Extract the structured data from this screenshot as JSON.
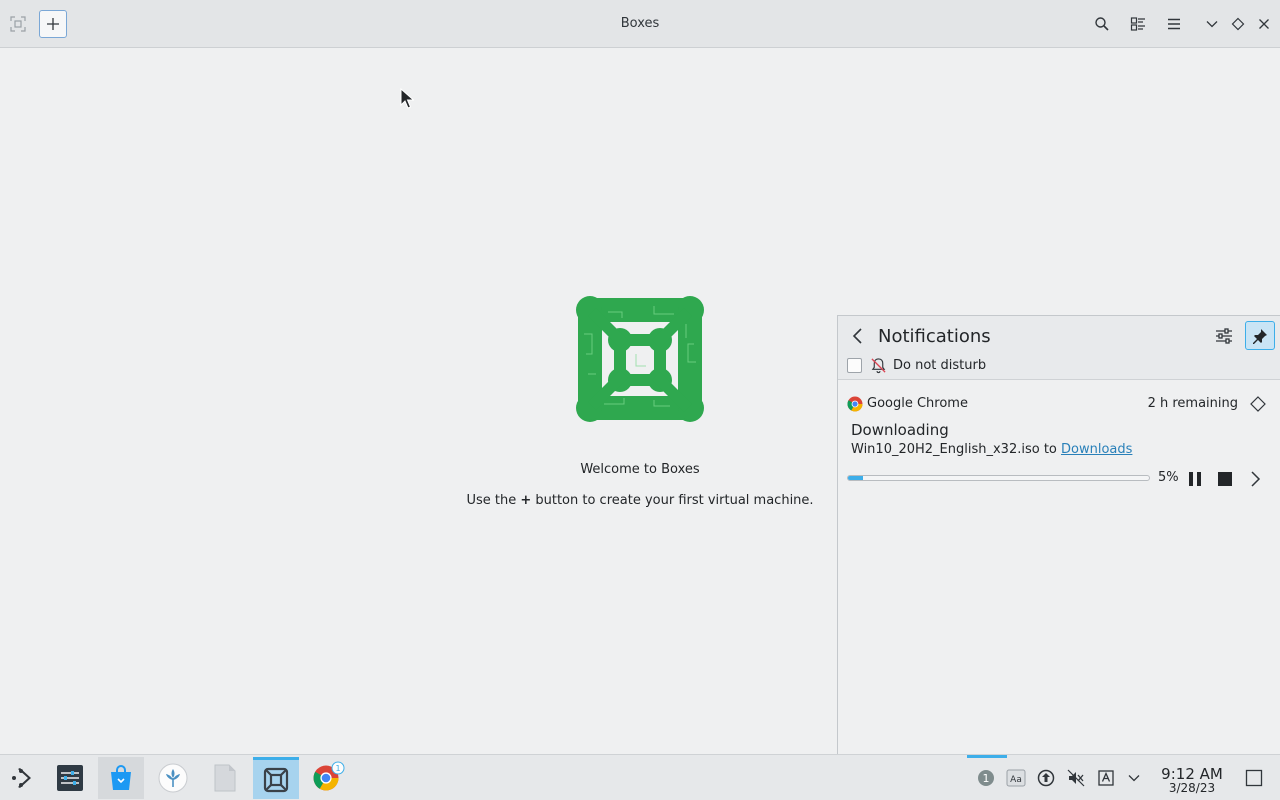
{
  "window": {
    "title": "Boxes"
  },
  "main": {
    "welcome": "Welcome to Boxes",
    "hint_before": "Use the ",
    "hint_plus": "+",
    "hint_after": " button to create your first virtual machine."
  },
  "notifications": {
    "title": "Notifications",
    "dnd_label": "Do not disturb",
    "dnd_checked": false,
    "item": {
      "app_name": "Google Chrome",
      "remaining": "2 h remaining",
      "title": "Downloading",
      "body_text": "Win10_20H2_English_x32.iso to ",
      "body_link": "Downloads",
      "progress_percent": 5,
      "progress_label": "5%"
    }
  },
  "taskbar": {
    "time": "9:12 AM",
    "date": "3/28/23",
    "chrome_badge": "1",
    "tray_badge": "1"
  },
  "colors": {
    "accent": "#3daee9",
    "logo_green": "#2fa84f",
    "link": "#2980b9"
  },
  "icons": {
    "header": [
      "fullscreen-icon",
      "add-icon",
      "search-icon",
      "select-icon",
      "menu-icon",
      "minimize-icon",
      "maximize-icon",
      "close-icon"
    ],
    "taskbar": [
      "app-launcher-icon",
      "settings-icon",
      "discover-icon",
      "vm-icon",
      "files-icon",
      "boxes-icon",
      "chrome-icon"
    ],
    "tray": [
      "notification-icon",
      "font-icon",
      "network-icon",
      "volume-muted-icon",
      "input-method-icon",
      "expand-tray-icon",
      "show-desktop-icon"
    ]
  }
}
